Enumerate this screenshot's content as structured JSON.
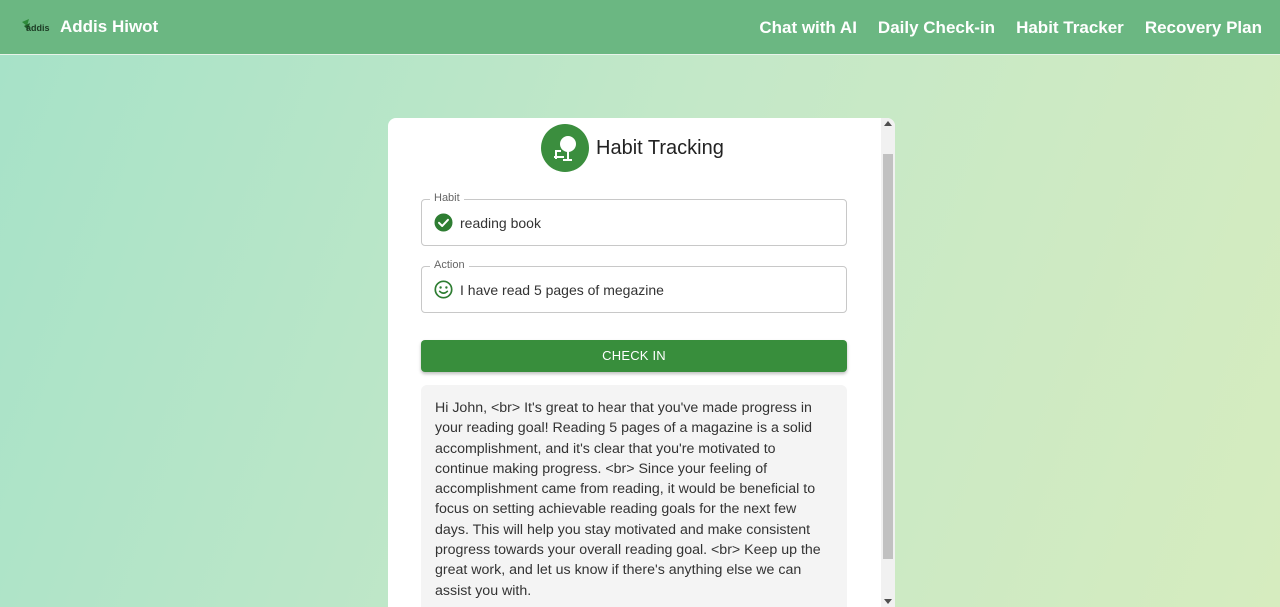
{
  "brand": {
    "logo_text": "addis",
    "name": "Addis Hiwot"
  },
  "nav": {
    "items": [
      {
        "label": "Chat with AI"
      },
      {
        "label": "Daily Check-in"
      },
      {
        "label": "Habit Tracker"
      },
      {
        "label": "Recovery Plan"
      }
    ]
  },
  "card": {
    "title": "Habit Tracking",
    "icon": "tree-bench-icon",
    "habit": {
      "label": "Habit",
      "value": "reading book",
      "icon": "check-circle-icon"
    },
    "action": {
      "label": "Action",
      "value": "I have read 5 pages of megazine",
      "icon": "smiley-icon"
    },
    "check_in_label": "CHECK IN",
    "response": "Hi John, <br> It's great to hear that you've made progress in your reading goal! Reading 5 pages of a magazine is a solid accomplishment, and it's clear that you're motivated to continue making progress. <br> Since your feeling of accomplishment came from reading, it would be beneficial to focus on setting achievable reading goals for the next few days. This will help you stay motivated and make consistent progress towards your overall reading goal. <br> Keep up the great work, and let us know if there's anything else we can assist you with."
  },
  "colors": {
    "navbar": "#6bb782",
    "accent": "#388e3c",
    "icon_green": "#2e7d32"
  }
}
